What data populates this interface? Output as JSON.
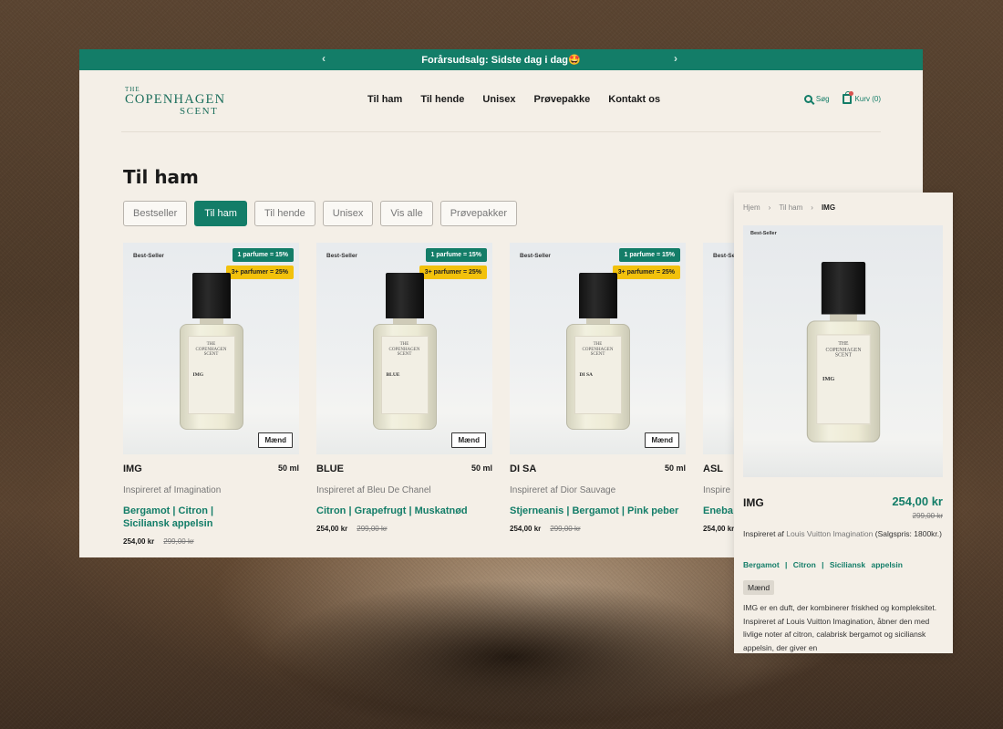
{
  "announcement": {
    "text": "Forårsudsalg: Sidste dag i dag🤩",
    "prev": "‹",
    "next": "›"
  },
  "logo": {
    "top": "THE",
    "main": "COPENHAGEN",
    "bottom": "SCENT"
  },
  "nav": [
    "Til ham",
    "Til hende",
    "Unisex",
    "Prøvepakke",
    "Kontakt os"
  ],
  "header_right": {
    "search": "Søg",
    "cart": "Kurv (0)"
  },
  "page_title": "Til ham",
  "filters": [
    {
      "label": "Bestseller",
      "active": false
    },
    {
      "label": "Til ham",
      "active": true
    },
    {
      "label": "Til hende",
      "active": false
    },
    {
      "label": "Unisex",
      "active": false
    },
    {
      "label": "Vis alle",
      "active": false
    },
    {
      "label": "Prøvepakker",
      "active": false
    }
  ],
  "products": [
    {
      "badge": "Best-Seller",
      "tag1": "1 parfume = 15%",
      "tag2": "3+ parfumer = 25%",
      "gender": "Mænd",
      "name": "IMG",
      "size": "50 ml",
      "inspired": "Inspireret af Imagination",
      "notes": "Bergamot | Citron | Siciliansk appelsin",
      "price": "254,00 kr",
      "old_price": "299,00 kr",
      "label": "IMG"
    },
    {
      "badge": "Best-Seller",
      "tag1": "1 parfume = 15%",
      "tag2": "3+ parfumer = 25%",
      "gender": "Mænd",
      "name": "BLUE",
      "size": "50 ml",
      "inspired": "Inspireret af Bleu De Chanel",
      "notes": "Citron | Grapefrugt | Muskatnød",
      "price": "254,00 kr",
      "old_price": "299,00 kr",
      "label": "BLUE"
    },
    {
      "badge": "Best-Seller",
      "tag1": "1 parfume = 15%",
      "tag2": "3+ parfumer = 25%",
      "gender": "Mænd",
      "name": "DI SA",
      "size": "50 ml",
      "inspired": "Inspireret af Dior Sauvage",
      "notes": "Stjerneanis | Bergamot | Pink peber",
      "price": "254,00 kr",
      "old_price": "299,00 kr",
      "label": "DI SA"
    },
    {
      "badge": "Best-Se",
      "tag1": "",
      "tag2": "",
      "gender": "",
      "name": "ASL",
      "size": "",
      "inspired": "Inspire",
      "notes": "Eneba",
      "price": "254,00 kr",
      "old_price": "",
      "label": "ASL"
    }
  ],
  "detail": {
    "breadcrumb": [
      "Hjem",
      "Til ham",
      "IMG"
    ],
    "badge": "Best-Seller",
    "title": "IMG",
    "price": "254,00 kr",
    "old_price": "299,00 kr",
    "inspired_prefix": "Inspireret af ",
    "inspired_name": "Louis Vuitton Imagination",
    "inspired_suffix": " (Salgspris: 1800kr.)",
    "notes": "Bergamot | Citron | Siciliansk appelsin",
    "gender": "Mænd",
    "description": "IMG er en duft, der kombinerer friskhed og kompleksitet. Inspireret af Louis Vuitton Imagination, åbner den med livlige noter af citron, calabrisk bergamot og siciliansk appelsin, der giver en"
  },
  "colors": {
    "accent": "#137d68",
    "promo_yellow": "#f2c10c",
    "page_bg": "#f4efe7"
  }
}
